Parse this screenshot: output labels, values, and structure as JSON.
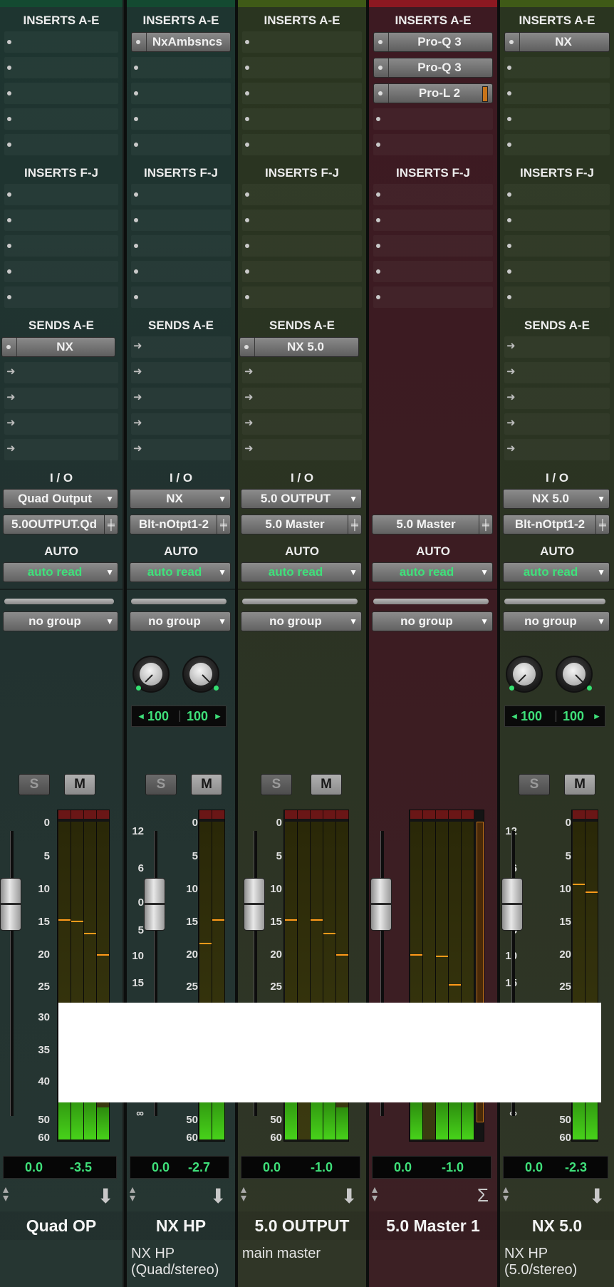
{
  "sections": {
    "inserts_ae": "INSERTS A-E",
    "inserts_fj": "INSERTS F-J",
    "sends_ae": "SENDS A-E",
    "io": "I / O",
    "auto": "AUTO"
  },
  "colors": {
    "green_strip": "#233530",
    "olive_strip": "#2b3220",
    "red_strip": "#3c1c22",
    "meter_green": "#3fd71b",
    "readout_green": "#3fe07a",
    "peak_orange": "#ff9a1a"
  },
  "icons": {
    "insert_dot": "insert-slot-dot-icon",
    "send_arrow": "send-arrow-icon",
    "dropdown": "triangle-down-icon",
    "pan_toggle": "pan-fader-icon",
    "nav": "up-down-arrows-icon",
    "output_arrow": "down-arrow-icon",
    "sum": "sigma-icon"
  },
  "scales": {
    "meter_ticks": [
      "0",
      "5",
      "10",
      "15",
      "20",
      "25",
      "30",
      "35",
      "40",
      "50",
      "60"
    ],
    "fader_ticks": [
      "12",
      "6",
      "0",
      "5",
      "10",
      "15",
      "∞"
    ]
  },
  "channels": [
    {
      "id": "quad-op",
      "color": "green",
      "inserts_ae": [
        "",
        "",
        "",
        "",
        ""
      ],
      "inserts_fj": [
        "",
        "",
        "",
        "",
        ""
      ],
      "sends_ae": [
        "NX",
        "",
        "",
        "",
        ""
      ],
      "io_output": "Quad Output",
      "io_path": "5.0OUTPUT.Qd",
      "automation": "auto read",
      "group": "no group",
      "pan": null,
      "solo": "S",
      "mute": "M",
      "meter_channels": 4,
      "meter_peaks": [
        16.2,
        16.4,
        18.3,
        21.6
      ],
      "meter_levels": [
        0.15,
        0.15,
        0.12,
        0.1
      ],
      "readout_volume": "0.0",
      "readout_peak": "-3.5",
      "output_icon": "down-arrow-icon",
      "name": "Quad OP",
      "comment": ""
    },
    {
      "id": "nx-hp",
      "color": "green",
      "inserts_ae": [
        "NxAmbsncs",
        "",
        "",
        "",
        ""
      ],
      "inserts_fj": [
        "",
        "",
        "",
        "",
        ""
      ],
      "sends_ae": [
        "",
        "",
        "",
        "",
        ""
      ],
      "io_output": "NX",
      "io_path": "Blt-nOtpt1-2",
      "automation": "auto read",
      "group": "no group",
      "pan": [
        "100",
        "100"
      ],
      "solo": "S",
      "mute": "M",
      "meter_channels": 2,
      "meter_peaks": [
        19.8,
        16.2
      ],
      "meter_levels": [
        0.15,
        0.15
      ],
      "readout_volume": "0.0",
      "readout_peak": "-2.7",
      "output_icon": "down-arrow-icon",
      "name": "NX HP",
      "comment": "NX HP (Quad/stereo)"
    },
    {
      "id": "5-0-output",
      "color": "olive",
      "inserts_ae": [
        "",
        "",
        "",
        "",
        ""
      ],
      "inserts_fj": [
        "",
        "",
        "",
        "",
        ""
      ],
      "sends_ae": [
        "NX 5.0",
        "",
        "",
        "",
        ""
      ],
      "io_output": "5.0 OUTPUT",
      "io_path": "5.0 Master",
      "automation": "auto read",
      "group": "no group",
      "pan": null,
      "solo": "S",
      "mute": "M",
      "meter_channels": 5,
      "meter_peaks": [
        16.2,
        31.0,
        16.2,
        18.3,
        21.6
      ],
      "meter_levels": [
        0.15,
        0.0,
        0.15,
        0.12,
        0.1
      ],
      "readout_volume": "0.0",
      "readout_peak": "-1.0",
      "output_icon": "down-arrow-icon",
      "name": "5.0 OUTPUT",
      "comment": "main master"
    },
    {
      "id": "5-0-master-1",
      "color": "red",
      "inserts_ae": [
        "Pro-Q 3",
        "Pro-Q 3",
        "Pro-L 2",
        "",
        ""
      ],
      "inserts_fj": [
        "",
        "",
        "",
        "",
        ""
      ],
      "sends_ae": null,
      "io_output": "",
      "io_path": "5.0 Master",
      "automation": "auto read",
      "group": "no group",
      "pan": null,
      "solo": "",
      "mute": "",
      "meter_channels": 5,
      "meter_peaks": [
        21.6,
        31.0,
        21.8,
        26.3,
        0.0
      ],
      "meter_levels": [
        0.12,
        0.0,
        0.12,
        0.12,
        0.12
      ],
      "readout_volume": "0.0",
      "readout_peak": "-1.0",
      "output_icon": "sigma-icon",
      "name": "5.0 Master 1",
      "comment": ""
    },
    {
      "id": "nx-5-0",
      "color": "olive",
      "inserts_ae": [
        "NX",
        "",
        "",
        "",
        ""
      ],
      "inserts_fj": [
        "",
        "",
        "",
        "",
        ""
      ],
      "sends_ae": [
        "",
        "",
        "",
        "",
        ""
      ],
      "io_output": "NX 5.0",
      "io_path": "Blt-nOtpt1-2",
      "automation": "auto read",
      "group": "no group",
      "pan": [
        "100",
        "100"
      ],
      "solo": "S",
      "mute": "M",
      "meter_channels": 2,
      "meter_peaks": [
        10.8,
        12.0
      ],
      "meter_levels": [
        0.15,
        0.15
      ],
      "readout_volume": "0.0",
      "readout_peak": "-2.3",
      "output_icon": "down-arrow-icon",
      "name": "NX 5.0",
      "comment": "NX HP (5.0/stereo)"
    }
  ]
}
